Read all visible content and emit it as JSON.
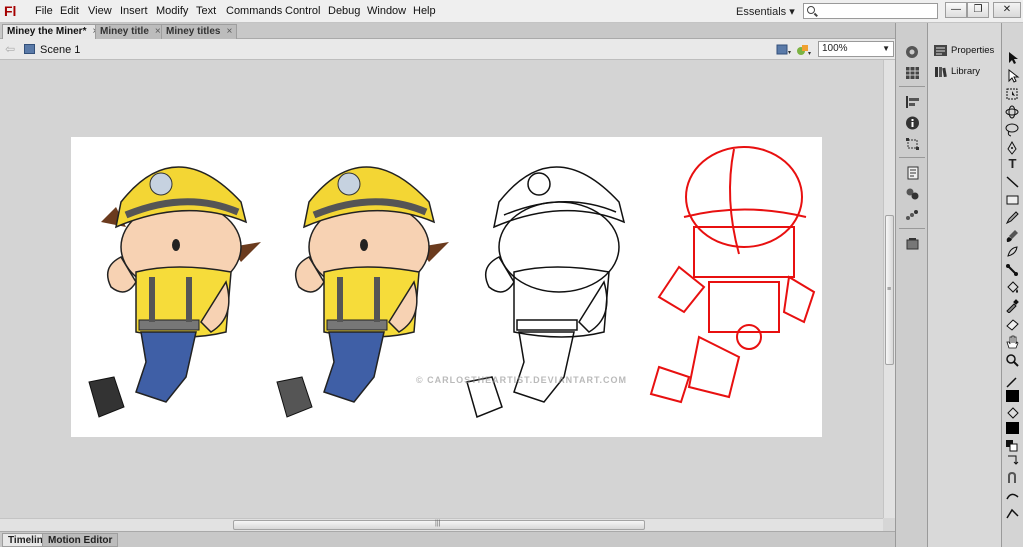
{
  "app": {
    "logo": "Fl"
  },
  "menu": [
    "File",
    "Edit",
    "View",
    "Insert",
    "Modify",
    "Text",
    "Commands",
    "Control",
    "Debug",
    "Window",
    "Help"
  ],
  "workspace": {
    "label": "Essentials",
    "caret": "▾"
  },
  "search": {
    "placeholder": ""
  },
  "window_controls": {
    "minimize": "—",
    "restore": "❐",
    "close": "✕"
  },
  "doc_tabs": [
    {
      "label": "Miney the Miner*",
      "active": true
    },
    {
      "label": "Miney title",
      "active": false
    },
    {
      "label": "Miney titles",
      "active": false
    }
  ],
  "scene": {
    "label": "Scene 1"
  },
  "zoom": {
    "value": "100%"
  },
  "panels": {
    "properties": "Properties",
    "library": "Library"
  },
  "bottom_tabs": [
    {
      "label": "Timeline",
      "active": true
    },
    {
      "label": "Motion Editor",
      "active": false
    }
  ],
  "watermark": "© CARLOSTHEARTIST.DEVIANTART.COM",
  "colors": {
    "helmet": "#f3d634",
    "shirt": "#f6dc3a",
    "pants": "#3f5fa6",
    "skin": "#f7d2b3",
    "hair": "#6b3b1e",
    "sketch_red": "#e81010",
    "stroke_fill": "#000000",
    "fill_color": "#000000"
  }
}
